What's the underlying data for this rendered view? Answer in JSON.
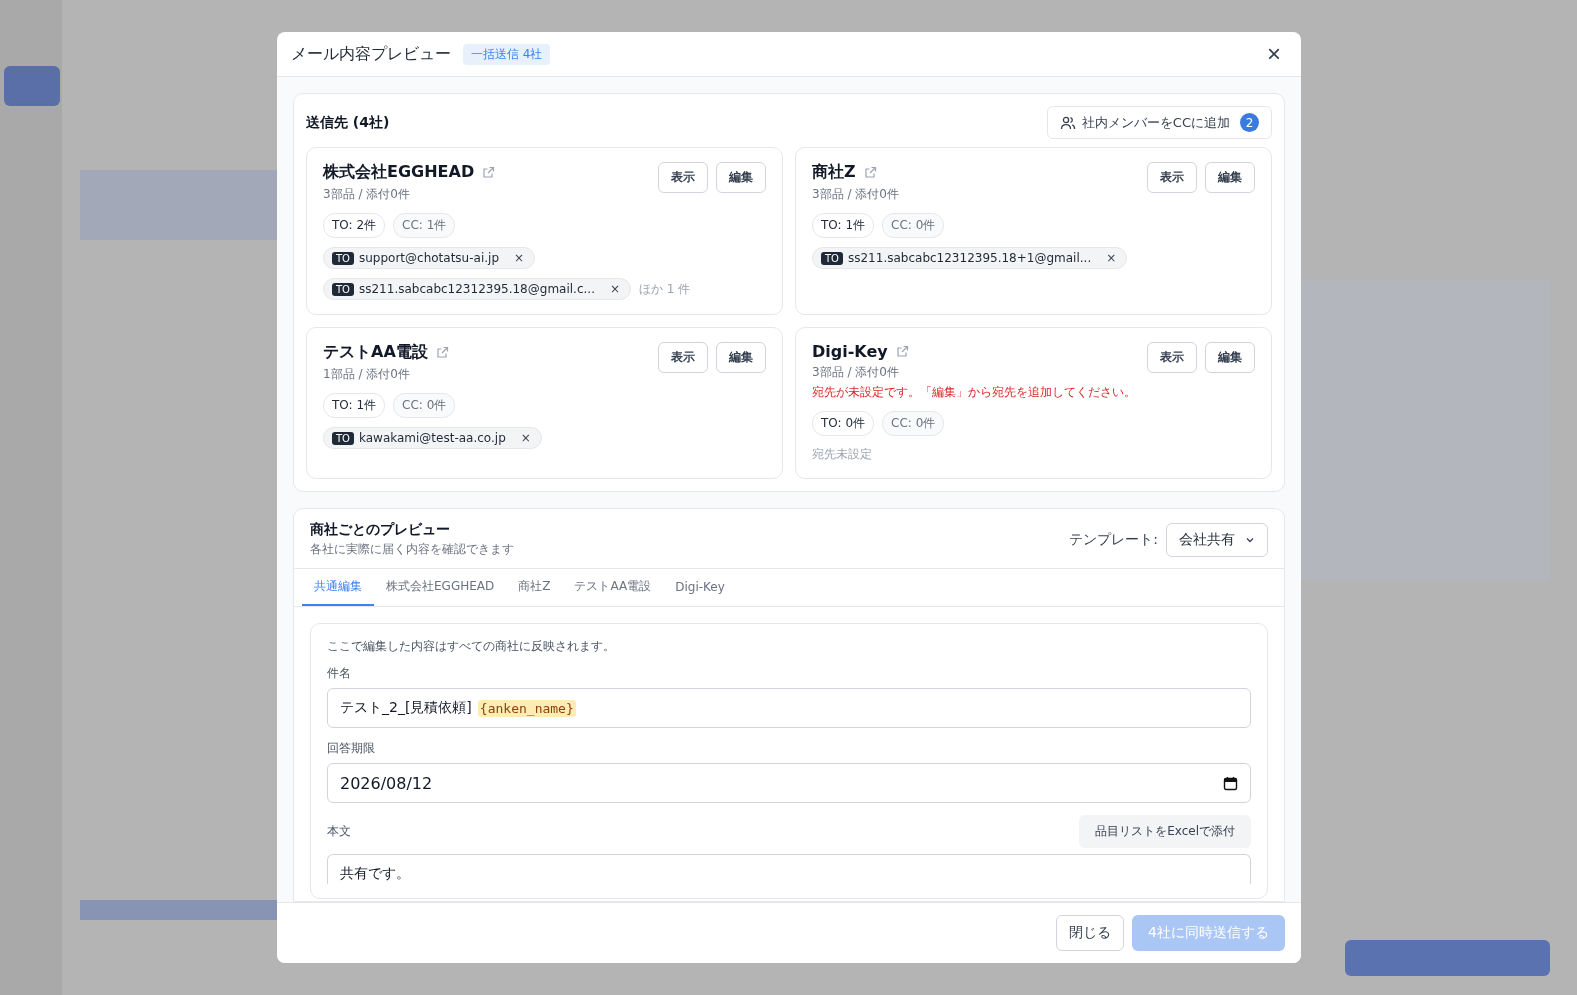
{
  "dialog": {
    "title": "メール内容プレビュー",
    "badge": "一括送信 4社",
    "close": "×"
  },
  "recipients": {
    "heading": "送信先 (4社)",
    "cc_button": {
      "label": "社内メンバーをCCに追加",
      "count": "2"
    },
    "companies": [
      {
        "name": "株式会社EGGHEAD",
        "meta": "3部品 / 添付0件",
        "view": "表示",
        "edit": "編集",
        "to_count": "TO: 2件",
        "cc_count": "CC: 1件",
        "addresses": [
          {
            "type": "TO",
            "email": "support@chotatsu-ai.jp",
            "remove": "×"
          },
          {
            "type": "TO",
            "email": "ss211.sabcabc12312395.18@gmail.c...",
            "remove": "×"
          }
        ],
        "more": "ほか 1 件"
      },
      {
        "name": "商社Z",
        "meta": "3部品 / 添付0件",
        "view": "表示",
        "edit": "編集",
        "to_count": "TO: 1件",
        "cc_count": "CC: 0件",
        "addresses": [
          {
            "type": "TO",
            "email": "ss211.sabcabc12312395.18+1@gmail...",
            "remove": "×"
          }
        ]
      },
      {
        "name": "テストAA電設",
        "meta": "1部品 / 添付0件",
        "view": "表示",
        "edit": "編集",
        "to_count": "TO: 1件",
        "cc_count": "CC: 0件",
        "addresses": [
          {
            "type": "TO",
            "email": "kawakami@test-aa.co.jp",
            "remove": "×"
          }
        ]
      },
      {
        "name": "Digi-Key",
        "meta": "3部品 / 添付0件",
        "warning": "宛先が未設定です。「編集」から宛先を追加してください。",
        "view": "表示",
        "edit": "編集",
        "to_count": "TO: 0件",
        "cc_count": "CC: 0件",
        "empty_note": "宛先未設定"
      }
    ]
  },
  "preview": {
    "title": "商社ごとのプレビュー",
    "subtitle": "各社に実際に届く内容を確認できます",
    "template_label": "テンプレート:",
    "template_value": "会社共有",
    "tabs": [
      {
        "label": "共通編集",
        "selected": true
      },
      {
        "label": "株式会社EGGHEAD",
        "selected": false
      },
      {
        "label": "商社Z",
        "selected": false
      },
      {
        "label": "テストAA電設",
        "selected": false
      },
      {
        "label": "Digi-Key",
        "selected": false
      }
    ],
    "note": "ここで編集した内容はすべての商社に反映されます。",
    "subject_label": "件名",
    "subject": {
      "text": "テスト_2_[見積依頼]",
      "variable": "{anken_name}"
    },
    "deadline_label": "回答期限",
    "deadline": "2026/08/12",
    "body_label": "本文",
    "attach_button": "品目リストをExcelで添付",
    "body": "共有です。"
  },
  "footer": {
    "close": "閉じる",
    "send": {
      "label": "4社に同時送信する",
      "disabled": true
    }
  }
}
